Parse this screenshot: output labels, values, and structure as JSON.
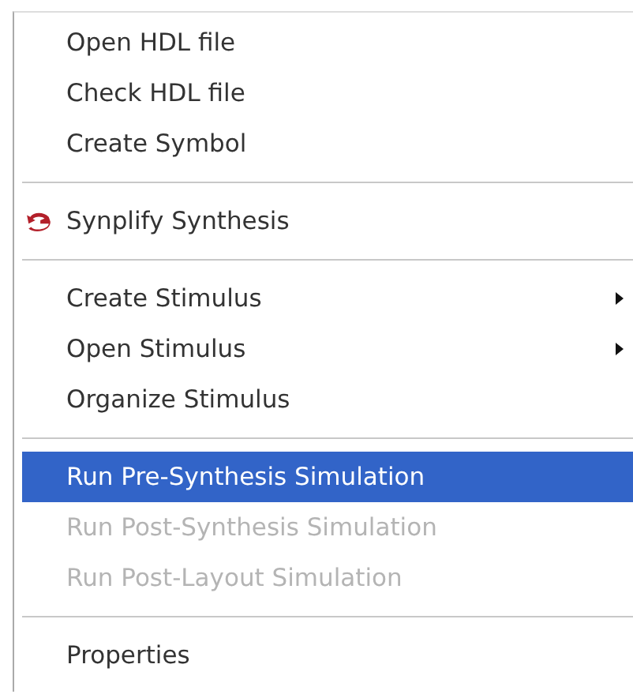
{
  "menu": {
    "items": [
      {
        "kind": "item",
        "label": "Open HDL file",
        "icon": false,
        "submenu": false,
        "selected": false,
        "disabled": false
      },
      {
        "kind": "item",
        "label": "Check HDL file",
        "icon": false,
        "submenu": false,
        "selected": false,
        "disabled": false
      },
      {
        "kind": "item",
        "label": "Create Symbol",
        "icon": false,
        "submenu": false,
        "selected": false,
        "disabled": false
      },
      {
        "kind": "separator"
      },
      {
        "kind": "item",
        "label": "Synplify Synthesis",
        "icon": true,
        "submenu": false,
        "selected": false,
        "disabled": false
      },
      {
        "kind": "separator"
      },
      {
        "kind": "item",
        "label": "Create Stimulus",
        "icon": false,
        "submenu": true,
        "selected": false,
        "disabled": false
      },
      {
        "kind": "item",
        "label": "Open Stimulus",
        "icon": false,
        "submenu": true,
        "selected": false,
        "disabled": false
      },
      {
        "kind": "item",
        "label": "Organize Stimulus",
        "icon": false,
        "submenu": false,
        "selected": false,
        "disabled": false
      },
      {
        "kind": "separator"
      },
      {
        "kind": "item",
        "label": "Run Pre-Synthesis Simulation",
        "icon": false,
        "submenu": false,
        "selected": true,
        "disabled": false
      },
      {
        "kind": "item",
        "label": "Run Post-Synthesis Simulation",
        "icon": false,
        "submenu": false,
        "selected": false,
        "disabled": true
      },
      {
        "kind": "item",
        "label": "Run Post-Layout Simulation",
        "icon": false,
        "submenu": false,
        "selected": false,
        "disabled": true
      },
      {
        "kind": "separator"
      },
      {
        "kind": "item",
        "label": "Properties",
        "icon": false,
        "submenu": false,
        "selected": false,
        "disabled": false
      }
    ]
  }
}
